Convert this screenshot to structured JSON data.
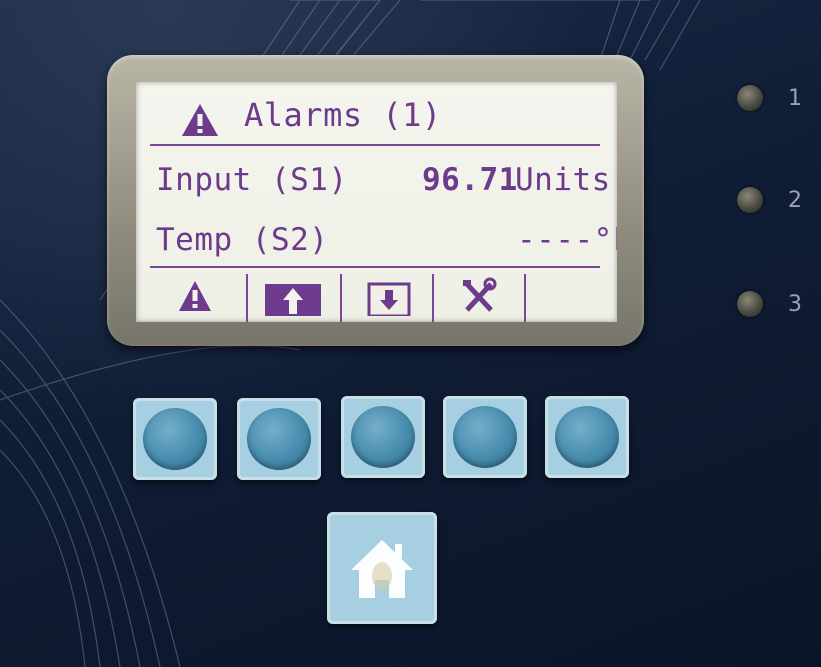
{
  "display": {
    "alarm_header": "Alarms (1)",
    "rows": [
      {
        "label": "Input (S1)",
        "value": "96.71",
        "unit": "Units"
      },
      {
        "label": "Temp (S2)",
        "value": "----°F",
        "unit": ""
      }
    ],
    "softkeys": [
      {
        "icon": "warning-icon"
      },
      {
        "icon": "up-arrow-icon"
      },
      {
        "icon": "down-arrow-icon"
      },
      {
        "icon": "tools-icon"
      },
      {
        "icon": ""
      }
    ]
  },
  "leds": [
    {
      "number": "1"
    },
    {
      "number": "2"
    },
    {
      "number": "3"
    }
  ],
  "colors": {
    "lcd_text": "#6d3a8c",
    "lcd_background": "#f2f3ec",
    "button_face": "#a7cfe2",
    "panel_background": "#0f1d36"
  },
  "home_button": {
    "icon": "home-icon"
  }
}
